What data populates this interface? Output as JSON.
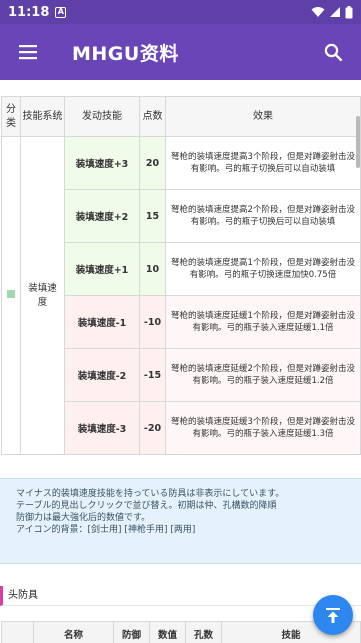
{
  "status_bar": {
    "time": "11:18",
    "app_icon_letter": "A"
  },
  "app_bar": {
    "title": "MHGU资料"
  },
  "skill_table": {
    "headers": {
      "category": "分类",
      "skill_system": "技能系统",
      "activated": "发动技能",
      "points": "点数",
      "effect": "效果"
    },
    "skill_system_name": "装填速度",
    "rows": [
      {
        "skill": "装填速度+3",
        "points": "20",
        "effect": "弩枪的装填速度提高3个阶段，但是对蹲姿射击没有影响。弓的瓶子切换后可以自动装填",
        "type": "positive"
      },
      {
        "skill": "装填速度+2",
        "points": "15",
        "effect": "弩枪的装填速度提高2个阶段，但是对蹲姿射击没有影响。弓的瓶子切换后可以自动装填",
        "type": "positive"
      },
      {
        "skill": "装填速度+1",
        "points": "10",
        "effect": "弩枪的装填速度提高1个阶段，但是对蹲姿射击没有影响。弓的瓶子切换速度加快0.75倍",
        "type": "positive"
      },
      {
        "skill": "装填速度-1",
        "points": "-10",
        "effect": "弩枪的装填速度延缓1个阶段，但是对蹲姿射击没有影响。弓的瓶子装入速度延缓1.1倍",
        "type": "negative"
      },
      {
        "skill": "装填速度-2",
        "points": "-15",
        "effect": "弩枪的装填速度延缓2个阶段，但是对蹲姿射击没有影响。弓的瓶子装入速度延缓1.2倍",
        "type": "negative"
      },
      {
        "skill": "装填速度-3",
        "points": "-20",
        "effect": "弩枪的装填速度延缓3个阶段，但是对蹲姿射击没有影响。弓的瓶子装入速度延缓1.3倍",
        "type": "negative"
      }
    ]
  },
  "note": {
    "line1": "マイナス的装填速度技能を持っている防具は非表示にしています。",
    "line2": "テーブル的見出しクリックで並び替え。初期は仲、孔構数的降順",
    "line3": "防御力は最大強化后的数値です。",
    "line4": "アイコン的背景：[剑士用] [神枪手用] [两用]"
  },
  "armor_section": {
    "heading": "头防具",
    "columns": [
      "名称",
      "防御",
      "数值",
      "孔数",
      "技能"
    ]
  },
  "fab": {
    "icon": "arrow-up-to-top-icon"
  },
  "colors": {
    "app_bar": "#6a45b8",
    "positive": "#2a8a19",
    "negative": "#d01818",
    "fab": "#2d87ee",
    "section_marker": "#d83ea6"
  }
}
